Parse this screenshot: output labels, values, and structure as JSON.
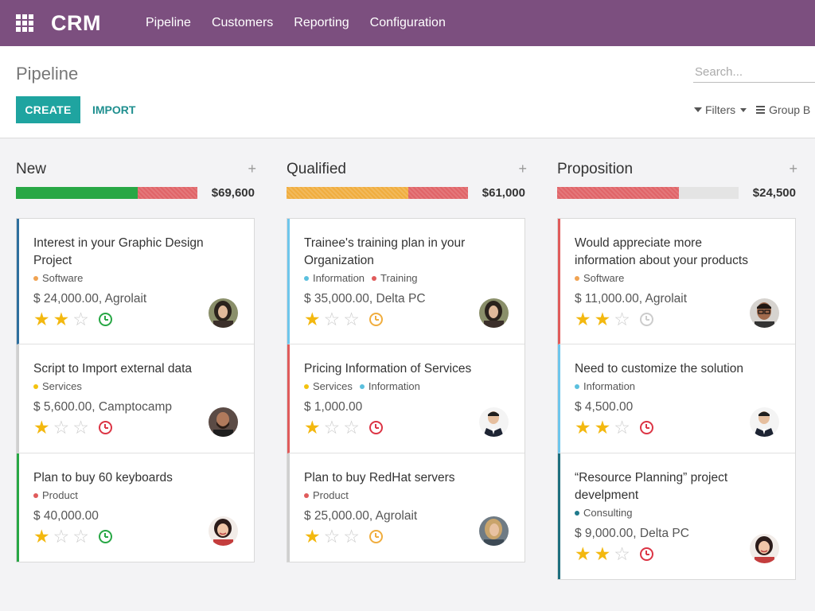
{
  "app": {
    "brand": "CRM",
    "menu": [
      "Pipeline",
      "Customers",
      "Reporting",
      "Configuration"
    ]
  },
  "control": {
    "breadcrumb": "Pipeline",
    "create_label": "CREATE",
    "import_label": "IMPORT",
    "search_placeholder": "Search...",
    "filters_label": "Filters",
    "group_by_label": "Group B"
  },
  "colors": {
    "navbar": "#7c4f7f",
    "accent": "#1fa4a0",
    "star": "#f3b80f",
    "green": "#28a745",
    "red": "#e06468",
    "orange": "#f0ad3e"
  },
  "columns": [
    {
      "title": "New",
      "total": "$69,600",
      "progress": [
        {
          "color": "green",
          "fraction": 0.67
        },
        {
          "color": "red",
          "fraction": 0.33
        }
      ],
      "cards": [
        {
          "title": "Interest in your Graphic Design Project",
          "tags": [
            {
              "label": "Software",
              "color": "#f0a352"
            }
          ],
          "amount": "$ 24,000.00, Agrolait",
          "stars": 2,
          "activity": "green",
          "border": "#2e6f9e",
          "avatar": "woman-dark-hair"
        },
        {
          "title": "Script to Import external data",
          "tags": [
            {
              "label": "Services",
              "color": "#f3c20f"
            }
          ],
          "amount": "$ 5,600.00, Camptocamp",
          "stars": 1,
          "activity": "red",
          "border": "#cfcfcf",
          "avatar": "man-beard"
        },
        {
          "title": "Plan to buy 60 keyboards",
          "tags": [
            {
              "label": "Product",
              "color": "#e05b5b"
            }
          ],
          "amount": "$ 40,000.00",
          "stars": 1,
          "activity": "green",
          "border": "#28a745",
          "avatar": "woman-smiling"
        }
      ]
    },
    {
      "title": "Qualified",
      "total": "$61,000",
      "progress": [
        {
          "color": "orange",
          "fraction": 0.67
        },
        {
          "color": "red",
          "fraction": 0.33
        }
      ],
      "cards": [
        {
          "title": "Trainee's training plan in your Organization",
          "tags": [
            {
              "label": "Information",
              "color": "#5bc0de"
            },
            {
              "label": "Training",
              "color": "#e05b5b"
            }
          ],
          "amount": "$ 35,000.00, Delta PC",
          "stars": 1,
          "activity": "orange",
          "border": "#6ec6ec",
          "avatar": "woman-dark-hair"
        },
        {
          "title": "Pricing Information of Services",
          "tags": [
            {
              "label": "Services",
              "color": "#f3c20f"
            },
            {
              "label": "Information",
              "color": "#5bc0de"
            }
          ],
          "amount": "$ 1,000.00",
          "stars": 1,
          "activity": "red",
          "border": "#e05b5b",
          "avatar": "man-suit"
        },
        {
          "title": "Plan to buy RedHat servers",
          "tags": [
            {
              "label": "Product",
              "color": "#e05b5b"
            }
          ],
          "amount": "$ 25,000.00, Agrolait",
          "stars": 1,
          "activity": "orange",
          "border": "#cfcfcf",
          "avatar": "woman-blonde"
        }
      ]
    },
    {
      "title": "Proposition",
      "total": "$24,500",
      "progress": [
        {
          "color": "red",
          "fraction": 0.67
        },
        {
          "color": "grey",
          "fraction": 0.33
        }
      ],
      "cards": [
        {
          "title": "Would appreciate more information about your products",
          "tags": [
            {
              "label": "Software",
              "color": "#f0a352"
            }
          ],
          "amount": "$ 11,000.00, Agrolait",
          "stars": 2,
          "activity": "grey",
          "border": "#e05b5b",
          "avatar": "man-glasses"
        },
        {
          "title": "Need to customize the solution",
          "tags": [
            {
              "label": "Information",
              "color": "#5bc0de"
            }
          ],
          "amount": "$ 4,500.00",
          "stars": 2,
          "activity": "red",
          "border": "#6ec6ec",
          "avatar": "man-suit"
        },
        {
          "title": "“Resource Planning” project develpment",
          "tags": [
            {
              "label": "Consulting",
              "color": "#1f7a8c"
            }
          ],
          "amount": "$ 9,000.00, Delta PC",
          "stars": 2,
          "activity": "red",
          "border": "#1f6f7f",
          "avatar": "woman-smiling"
        }
      ]
    }
  ]
}
